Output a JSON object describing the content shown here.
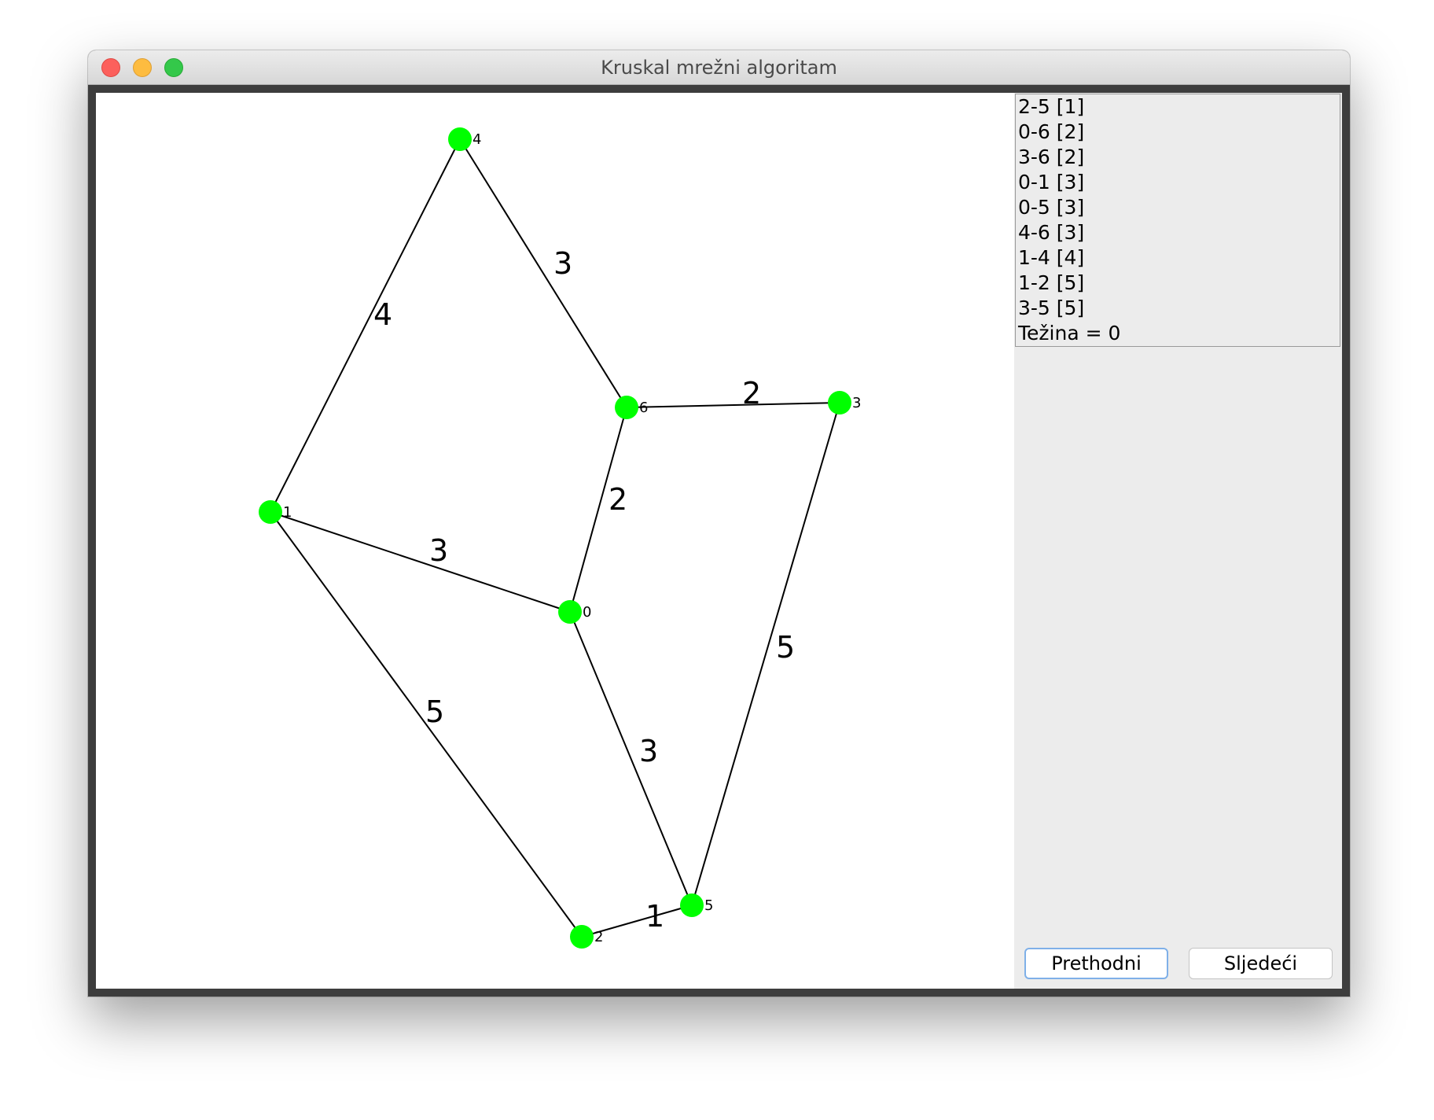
{
  "window": {
    "title": "Kruskal mrežni algoritam"
  },
  "graph": {
    "node_color": "#00ff00",
    "edge_color": "#000000",
    "nodes": [
      {
        "id": "0",
        "label": "0"
      },
      {
        "id": "1",
        "label": "1"
      },
      {
        "id": "2",
        "label": "2"
      },
      {
        "id": "3",
        "label": "3"
      },
      {
        "id": "4",
        "label": "4"
      },
      {
        "id": "5",
        "label": "5"
      },
      {
        "id": "6",
        "label": "6"
      }
    ],
    "edges": [
      {
        "from": "1",
        "to": "4",
        "weight": "4"
      },
      {
        "from": "4",
        "to": "6",
        "weight": "3"
      },
      {
        "from": "6",
        "to": "3",
        "weight": "2"
      },
      {
        "from": "0",
        "to": "6",
        "weight": "2"
      },
      {
        "from": "0",
        "to": "1",
        "weight": "3"
      },
      {
        "from": "1",
        "to": "2",
        "weight": "5"
      },
      {
        "from": "0",
        "to": "5",
        "weight": "3"
      },
      {
        "from": "3",
        "to": "5",
        "weight": "5"
      },
      {
        "from": "2",
        "to": "5",
        "weight": "1"
      }
    ]
  },
  "edge_list": [
    "2-5 [1]",
    "0-6 [2]",
    "3-6 [2]",
    "0-1 [3]",
    "0-5 [3]",
    "4-6 [3]",
    "1-4 [4]",
    "1-2 [5]",
    "3-5 [5]",
    "Težina = 0"
  ],
  "buttons": {
    "prev": "Prethodni",
    "next": "Sljedeći"
  }
}
